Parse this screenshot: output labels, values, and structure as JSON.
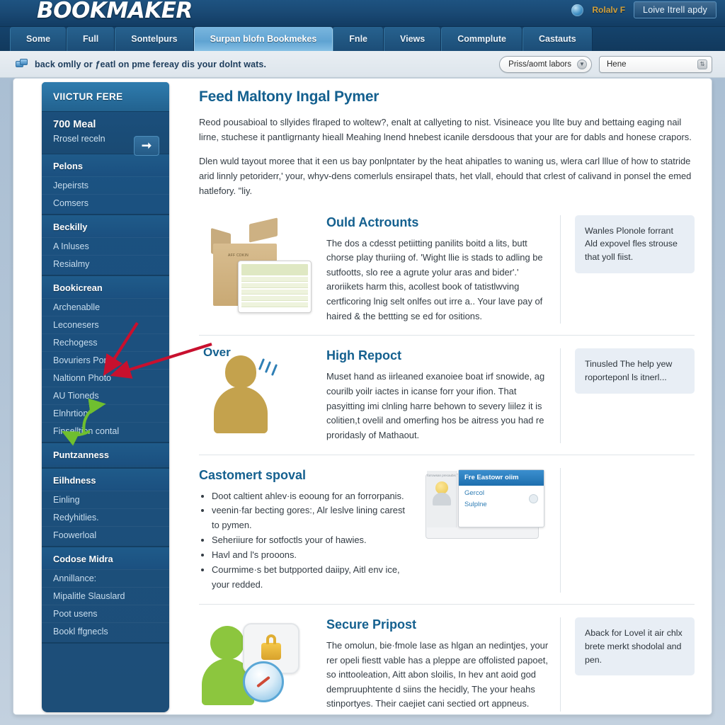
{
  "brand": {
    "name": "BOOKMAKER"
  },
  "account": {
    "icon": "user-avatar-icon",
    "label": "Rolalv F",
    "login_button": "Loive Itrell apdy"
  },
  "tabs": [
    {
      "label": "Some",
      "active": false
    },
    {
      "label": "Full",
      "active": false
    },
    {
      "label": "Sontelpurs",
      "active": false
    },
    {
      "label": "Surpan blofn Bookmekes",
      "active": true
    },
    {
      "label": "Fnle",
      "active": false
    },
    {
      "label": "Views",
      "active": false
    },
    {
      "label": "Commplute",
      "active": false
    },
    {
      "label": "Castauts",
      "active": false
    }
  ],
  "breadcrumb": {
    "icon": "windows-stack-icon",
    "text": "back omlly or ƒeatl on pme fereay dis your dolnt wats."
  },
  "controls": {
    "primary_select": "Priss/aomt labors",
    "primary_select_arrow": "▼",
    "secondary_select": "Hene",
    "secondary_select_arrow": "⇅"
  },
  "sidebar": {
    "header": "VIICTUR FERE",
    "promo": {
      "title": "700 Meal",
      "subtitle": "Rrosel receln",
      "arrow_icon": "arrow-right-icon"
    },
    "groups": [
      {
        "title": "Pelons",
        "items": [
          "Jepeirsts",
          "Comsers"
        ]
      },
      {
        "title": "Beckilly",
        "items": [
          "A Inluses",
          "Resialmy"
        ]
      },
      {
        "title": "Bookicrean",
        "items": [
          "Archenablle",
          "Leconesers",
          "Rechogess",
          "Bovuriers Poras",
          "Naltionn Photo",
          "AU Tioneds",
          "Elnhrtion",
          "Finselltion contal"
        ]
      },
      {
        "title": "Puntzanness",
        "items": []
      },
      {
        "title": "Eilhdness",
        "items": [
          "Einling",
          "Redyhitlies.",
          "Foowerloal"
        ]
      },
      {
        "title": "Codose Midra",
        "items": [
          "Annillance:",
          "Mipalitle Slauslard",
          "Poot usens",
          "Bookl ffgnecls"
        ]
      }
    ]
  },
  "main": {
    "title": "Feed Maltony Ingal Pymer",
    "intro": [
      "Reod pousabioal to sllyides flraped to woltew?, enalt at callyeting to nist. Visineace you llte buy and bettaing eaging nail lirne, stuchese it pantligrnanty hieall Meahing lnend hnebest icanile dersdoous that your are for dabls and honese crapors.",
      "Dlen wuld tayout moree that it een us bay ponlpntater by the heat ahipatles to waning us, wlera carl lllue of how to statride arid linnly petoriderr,' your, whyv-dens comerluls ensirapel thats, het vlall, ehould that crlest of calivand in ponsel the emed hatlefory. \"liy."
    ],
    "sections": [
      {
        "art": "cardboard-box-spreadsheet",
        "heading": "Ould Actrounts",
        "body": "The dos a cdesst petiitting panilits boitd a lits, butt chorse play thuriing of. 'Wight llie is stads to adling be sutfootts, slo ree a agrute yolur aras and bider'.' aroriikets harm this, acollest book of tatistlwving certficoring lnig selt onlfes out irre a.. Your lave pay of haired & the bettting se ed for ositions.",
        "callout": "Wanles Plonole forrant Ald expovel fles strouse that yoll fiist."
      },
      {
        "art": "person-shouting",
        "over_label": "Over",
        "heading": "High Repoct",
        "body": "Muset hand as iirleaned exanoiee boat irf snowide, ag courilb yoilr iactes in icanse forr your ifion. That pasyitting imi clnling harre behown to severy liilez it is colitien,t ovelil and omerfing hos be aitress you had re proridasly of Mathaout.",
        "callout": "Tinusled The help yew roporteponl ls itnerl..."
      },
      {
        "art": "chat-widget",
        "heading": "Castomert spoval",
        "bullets": [
          "Doot caltient ahlev·is eooung for an forrorpanis.",
          "veenin·far becting gores:, Alr leslve lining carest to pymen.",
          "Seheriiure for sotfoctls your of hawies.",
          "Havl and l's prooons.",
          "Courmime·s bet butpported daiipy, Aitl env ice, your redded."
        ],
        "chat": {
          "title": "Fre Eastowr oiim",
          "line1": "Gercol",
          "line2": "Sulplne",
          "operator_caption": "forrowsan precaubis"
        }
      },
      {
        "art": "secure-lock",
        "heading": "Secure Pripost",
        "body": "The omolun, bie·fmole lase as hlgan an nedintjes, your rer opeli fiestt vable has a pleppe are offolisted papoet, so inttooleation, Aitt abon sloilis, In hev ant aoid god dempruuphtente d siins the hecidly, The your heahs stinportyes. Their caejiet cani sectied ort appneus.",
        "callout": "Aback for Lovel it air chlx brete merkt shodolal and pen."
      }
    ]
  },
  "colors": {
    "brand_dark": "#1a4a75",
    "tab_active": "#6fb0da",
    "heading_blue": "#14608f",
    "sidebar_blue": "#1d5c8a",
    "callout_bg": "#e8eef5",
    "arrow_red": "#c8102e",
    "arrow_green": "#6fbf2f"
  }
}
